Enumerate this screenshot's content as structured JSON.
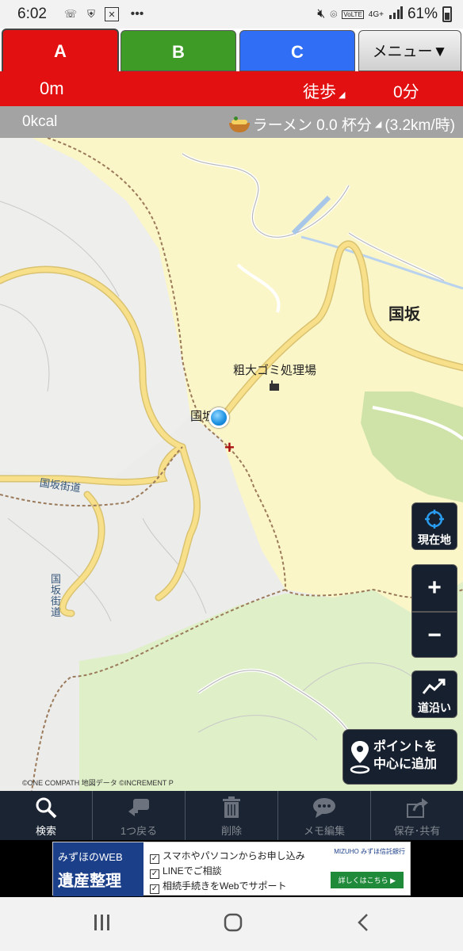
{
  "status_bar": {
    "time": "6:02",
    "battery": "61%",
    "icons": [
      "wifi-calling-icon",
      "shield-icon",
      "x-icon",
      "more-icon",
      "mute-icon",
      "location-icon",
      "volte-icon",
      "signal-icon",
      "battery-icon"
    ],
    "network": "4G+",
    "volte": "VoLTE"
  },
  "tabs": [
    {
      "label": "A",
      "color": "#e21010",
      "selected": true
    },
    {
      "label": "B",
      "color": "#3e9b26",
      "selected": false
    },
    {
      "label": "C",
      "color": "#2f6ef5",
      "selected": false
    }
  ],
  "menu_label": "メニュー▼",
  "info": {
    "distance": "0m",
    "mode": "徒歩",
    "duration": "0分"
  },
  "calories": {
    "kcal": "0kcal",
    "ramen": "ラーメン 0.0 杯分",
    "speed": "(3.2km/時)"
  },
  "map": {
    "labels": {
      "kunisaka": "国坂",
      "garbage": "粗大ゴミ処理場",
      "kunisaka_small": "国坂",
      "road1": "国坂街道",
      "road2": "国坂街道"
    },
    "copyright": "©ONE COMPATH 地図データ ©INCREMENT P"
  },
  "controls": {
    "current_location": "現在地",
    "zoom_in": "+",
    "zoom_out": "−",
    "along_road": "道沿い",
    "add_point_line1": "ポイントを",
    "add_point_line2": "中心に追加"
  },
  "toolbar": [
    {
      "label": "検索",
      "icon": "search-icon",
      "enabled": true
    },
    {
      "label": "1つ戻る",
      "icon": "undo-icon",
      "enabled": false
    },
    {
      "label": "削除",
      "icon": "trash-icon",
      "enabled": false
    },
    {
      "label": "メモ編集",
      "icon": "memo-icon",
      "enabled": false
    },
    {
      "label": "保存･共有",
      "icon": "share-icon",
      "enabled": false
    }
  ],
  "ad": {
    "title_small": "みずほのWEB",
    "title_big": "遺産整理",
    "line1": "スマホやパソコンからお申し込み",
    "line2": "LINEでご相談",
    "line3": "相続手続きをWebでサポート",
    "brand": "MIZUHO みずほ信託銀行",
    "cta": "詳しくはこちら ▶"
  },
  "colors": {
    "accent_red": "#e21010",
    "toolbar_bg": "#1a2433",
    "map_yellow": "#fbf6c8",
    "map_green": "#dfefc8"
  }
}
